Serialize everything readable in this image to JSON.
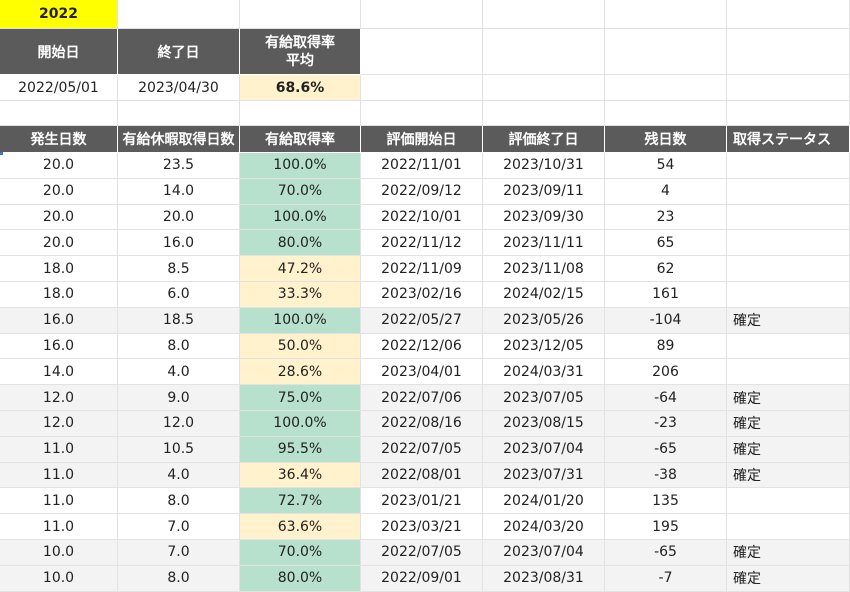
{
  "year": "2022",
  "summary": {
    "headers": [
      "開始日",
      "終了日",
      "有給取得率",
      "平均"
    ],
    "start_date": "2022/05/01",
    "end_date": "2023/04/30",
    "avg_rate": "68.6%"
  },
  "table": {
    "headers": [
      "発生日数",
      "有給休暇取得日数",
      "有給取得率",
      "評価開始日",
      "評価終了日",
      "残日数",
      "取得ステータス"
    ],
    "rows": [
      {
        "c": [
          "20.0",
          "23.5",
          "100.0%",
          "2022/11/01",
          "2023/10/31",
          "54",
          ""
        ],
        "rate": "green",
        "shade": false
      },
      {
        "c": [
          "20.0",
          "14.0",
          "70.0%",
          "2022/09/12",
          "2023/09/11",
          "4",
          ""
        ],
        "rate": "green",
        "shade": false
      },
      {
        "c": [
          "20.0",
          "20.0",
          "100.0%",
          "2022/10/01",
          "2023/09/30",
          "23",
          ""
        ],
        "rate": "green",
        "shade": false
      },
      {
        "c": [
          "20.0",
          "16.0",
          "80.0%",
          "2022/11/12",
          "2023/11/11",
          "65",
          ""
        ],
        "rate": "green",
        "shade": false
      },
      {
        "c": [
          "18.0",
          "8.5",
          "47.2%",
          "2022/11/09",
          "2023/11/08",
          "62",
          ""
        ],
        "rate": "yellow",
        "shade": false
      },
      {
        "c": [
          "18.0",
          "6.0",
          "33.3%",
          "2023/02/16",
          "2024/02/15",
          "161",
          ""
        ],
        "rate": "yellow",
        "shade": false
      },
      {
        "c": [
          "16.0",
          "18.5",
          "100.0%",
          "2022/05/27",
          "2023/05/26",
          "-104",
          "確定"
        ],
        "rate": "green",
        "shade": true
      },
      {
        "c": [
          "16.0",
          "8.0",
          "50.0%",
          "2022/12/06",
          "2023/12/05",
          "89",
          ""
        ],
        "rate": "yellow",
        "shade": false
      },
      {
        "c": [
          "14.0",
          "4.0",
          "28.6%",
          "2023/04/01",
          "2024/03/31",
          "206",
          ""
        ],
        "rate": "yellow",
        "shade": false
      },
      {
        "c": [
          "12.0",
          "9.0",
          "75.0%",
          "2022/07/06",
          "2023/07/05",
          "-64",
          "確定"
        ],
        "rate": "green",
        "shade": true
      },
      {
        "c": [
          "12.0",
          "12.0",
          "100.0%",
          "2022/08/16",
          "2023/08/15",
          "-23",
          "確定"
        ],
        "rate": "green",
        "shade": true
      },
      {
        "c": [
          "11.0",
          "10.5",
          "95.5%",
          "2022/07/05",
          "2023/07/04",
          "-65",
          "確定"
        ],
        "rate": "green",
        "shade": true
      },
      {
        "c": [
          "11.0",
          "4.0",
          "36.4%",
          "2022/08/01",
          "2023/07/31",
          "-38",
          "確定"
        ],
        "rate": "yellow",
        "shade": true
      },
      {
        "c": [
          "11.0",
          "8.0",
          "72.7%",
          "2023/01/21",
          "2024/01/20",
          "135",
          ""
        ],
        "rate": "green",
        "shade": false
      },
      {
        "c": [
          "11.0",
          "7.0",
          "63.6%",
          "2023/03/21",
          "2024/03/20",
          "195",
          ""
        ],
        "rate": "yellow",
        "shade": false
      },
      {
        "c": [
          "10.0",
          "7.0",
          "70.0%",
          "2022/07/05",
          "2023/07/04",
          "-65",
          "確定"
        ],
        "rate": "green",
        "shade": true
      },
      {
        "c": [
          "10.0",
          "8.0",
          "80.0%",
          "2022/09/01",
          "2023/08/31",
          "-7",
          "確定"
        ],
        "rate": "green",
        "shade": true
      }
    ]
  }
}
